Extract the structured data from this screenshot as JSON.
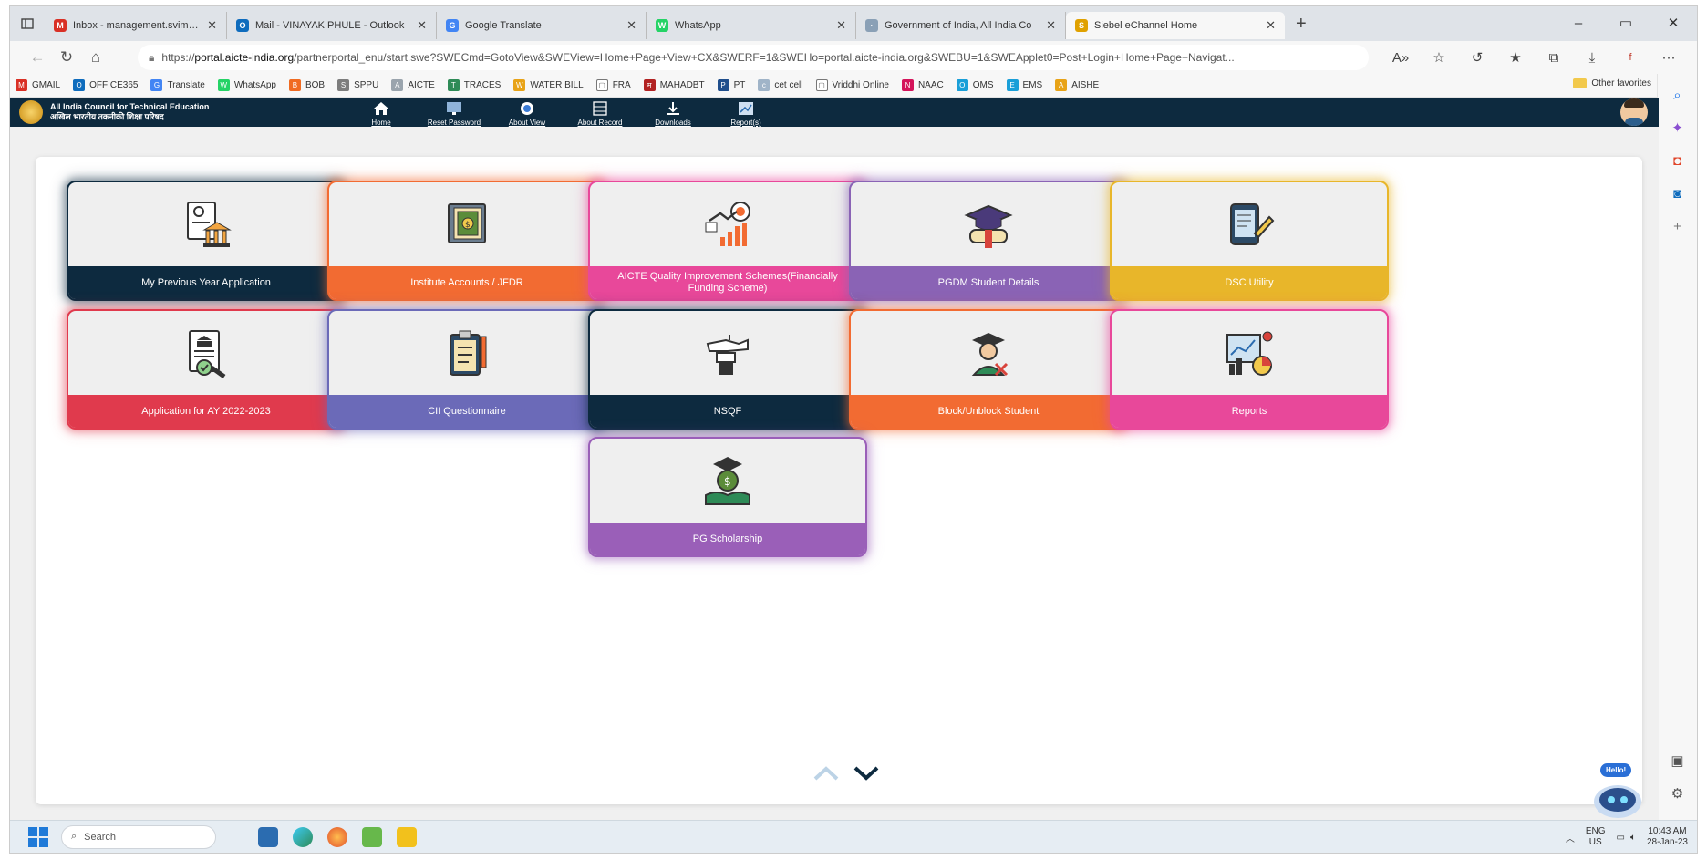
{
  "browser": {
    "tabs": [
      {
        "label": "Inbox - management.svims@gm",
        "color": "#d93025",
        "glyph": "M"
      },
      {
        "label": "Mail - VINAYAK PHULE - Outlook",
        "color": "#0f6cbd",
        "glyph": "O"
      },
      {
        "label": "Google Translate",
        "color": "#4285f4",
        "glyph": "G"
      },
      {
        "label": "WhatsApp",
        "color": "#25d366",
        "glyph": "W"
      },
      {
        "label": "Government of India, All India Co",
        "color": "#8aa0b6",
        "glyph": "·"
      },
      {
        "label": "Siebel eChannel Home",
        "color": "#e0a100",
        "glyph": "S"
      }
    ],
    "url_prefix": "https://",
    "url_domain": "portal.aicte-india.org",
    "url_rest": "/partnerportal_enu/start.swe?SWECmd=GotoView&SWEView=Home+Page+View+CX&SWERF=1&SWEHo=portal.aicte-india.org&SWEBU=1&SWEApplet0=Post+Login+Home+Page+Navigat...",
    "favorites": [
      {
        "label": "GMAIL",
        "color": "#d93025",
        "glyph": "M"
      },
      {
        "label": "OFFICE365",
        "color": "#0f6cbd",
        "glyph": "O"
      },
      {
        "label": "Translate",
        "color": "#4285f4",
        "glyph": "G"
      },
      {
        "label": "WhatsApp",
        "color": "#25d366",
        "glyph": "W"
      },
      {
        "label": "BOB",
        "color": "#f06b22",
        "glyph": "B"
      },
      {
        "label": "SPPU",
        "color": "#7d7d7d",
        "glyph": "S"
      },
      {
        "label": "AICTE",
        "color": "#9aa4ad",
        "glyph": "A"
      },
      {
        "label": "TRACES",
        "color": "#2e8b57",
        "glyph": "T"
      },
      {
        "label": "WATER BILL",
        "color": "#e8a317",
        "glyph": "W"
      },
      {
        "label": "FRA",
        "color": "#ffffff",
        "glyph": "▢"
      },
      {
        "label": "MAHADBT",
        "color": "#b22222",
        "glyph": "म"
      },
      {
        "label": "PT",
        "color": "#1f4e8c",
        "glyph": "P"
      },
      {
        "label": "cet cell",
        "color": "#a0b4c8",
        "glyph": "c"
      },
      {
        "label": "Vriddhi Online",
        "color": "#ffffff",
        "glyph": "▢"
      },
      {
        "label": "NAAC",
        "color": "#d4145a",
        "glyph": "N"
      },
      {
        "label": "OMS",
        "color": "#1a9fd8",
        "glyph": "O"
      },
      {
        "label": "EMS",
        "color": "#1a9fd8",
        "glyph": "E"
      },
      {
        "label": "AISHE",
        "color": "#e8a317",
        "glyph": "A"
      }
    ],
    "other_favorites": "Other favorites"
  },
  "app": {
    "org_en": "All India Council for Technical Education",
    "org_hi": "अखिल भारतीय तकनीकी शिक्षा परिषद",
    "nav": [
      "Home",
      "Reset Password",
      "About View",
      "About Record",
      "Downloads",
      "Report(s)"
    ]
  },
  "tiles": [
    {
      "label": "My Previous Year Application",
      "color": "#0d2a3f",
      "glow": "#0d2a3f",
      "icon": "bank-document-icon"
    },
    {
      "label": "Institute Accounts / JFDR",
      "color": "#f26b32",
      "glow": "#f26b32",
      "icon": "account-book-icon"
    },
    {
      "label": "AICTE Quality Improvement Schemes(Financially Funding Scheme)",
      "color": "#e8489a",
      "glow": "#e8489a",
      "icon": "growth-target-icon"
    },
    {
      "label": "PGDM Student Details",
      "color": "#8a63b5",
      "glow": "#8a63b5",
      "icon": "graduation-icon"
    },
    {
      "label": "DSC Utility",
      "color": "#e8b62a",
      "glow": "#e8b62a",
      "icon": "digital-sign-icon"
    },
    {
      "label": "Application for AY 2022-2023",
      "color": "#e03a4d",
      "glow": "#e03a4d",
      "icon": "approved-document-icon"
    },
    {
      "label": "CII Questionnaire",
      "color": "#6b6ab8",
      "glow": "#6b6ab8",
      "icon": "clipboard-icon"
    },
    {
      "label": "NSQF",
      "color": "#0d2a3f",
      "glow": "#0d2a3f",
      "icon": "skill-hand-icon"
    },
    {
      "label": "Block/Unblock Student",
      "color": "#f26b32",
      "glow": "#f26b32",
      "icon": "student-block-icon"
    },
    {
      "label": "Reports",
      "color": "#e8489a",
      "glow": "#e8489a",
      "icon": "report-chart-icon"
    },
    {
      "label": "PG Scholarship",
      "color": "#9a5fb8",
      "glow": "#9a5fb8",
      "icon": "scholarship-icon"
    }
  ],
  "chatbot_label": "Hello!",
  "taskbar": {
    "search_placeholder": "Search",
    "lang_line1": "ENG",
    "lang_line2": "US",
    "time": "10:43 AM",
    "date": "28-Jan-23"
  }
}
